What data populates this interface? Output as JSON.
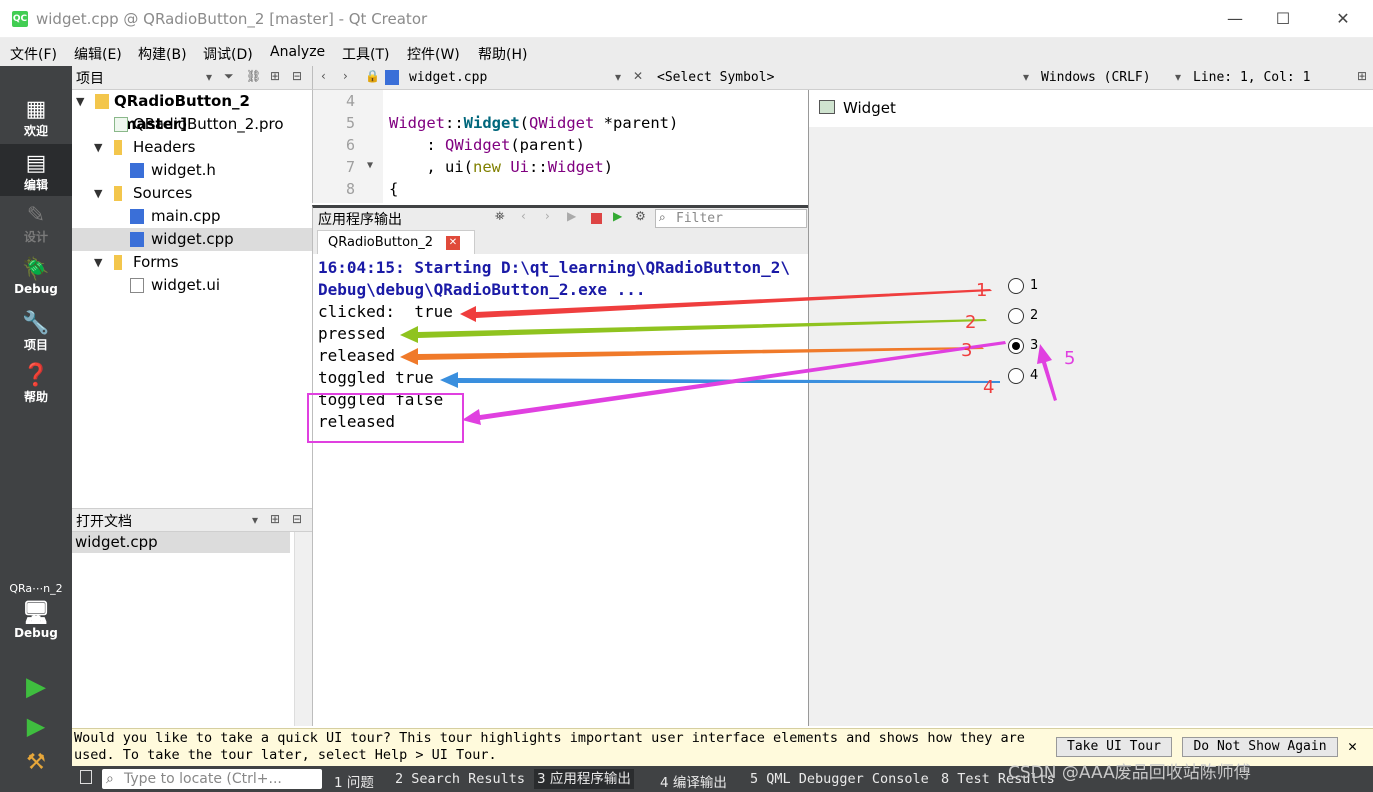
{
  "window": {
    "title": "widget.cpp @ QRadioButton_2 [master] - Qt Creator",
    "app_icon": "QC",
    "min": "—",
    "max": "☐",
    "close": "✕"
  },
  "menu": [
    "文件(F)",
    "编辑(E)",
    "构建(B)",
    "调试(D)",
    "Analyze",
    "工具(T)",
    "控件(W)",
    "帮助(H)"
  ],
  "modes": {
    "welcome": "欢迎",
    "edit": "编辑",
    "design": "设计",
    "debug": "Debug",
    "projects": "项目",
    "help": "帮助",
    "kit_name": "QRa⋯n_2",
    "kit_mode": "Debug"
  },
  "project_panel": {
    "title": "项目",
    "tree": {
      "root": "QRadioButton_2 [master]",
      "pro": "QRadioButton_2.pro",
      "headers": "Headers",
      "widget_h": "widget.h",
      "sources": "Sources",
      "main_cpp": "main.cpp",
      "widget_cpp": "widget.cpp",
      "forms": "Forms",
      "widget_ui": "widget.ui"
    }
  },
  "open_docs": {
    "title": "打开文档",
    "items": [
      "widget.cpp"
    ]
  },
  "editor": {
    "file": "widget.cpp",
    "symbol": "<Select Symbol>",
    "line_ending": "Windows (CRLF)",
    "position": "Line: 1, Col: 1",
    "line_numbers": [
      "4",
      "5",
      "6",
      "7",
      "8"
    ],
    "code": {
      "l5_a": "Widget",
      "l5_b": "::",
      "l5_c": "Widget",
      "l5_d": "(",
      "l5_e": "QWidget",
      "l5_f": " *parent)",
      "l6_a": "    : ",
      "l6_b": "QWidget",
      "l6_c": "(parent)",
      "l7_a": "    , ui(",
      "l7_b": "new",
      "l7_c": " ",
      "l7_d": "Ui",
      "l7_e": "::",
      "l7_f": "Widget",
      "l7_g": ")",
      "l8": "{"
    }
  },
  "output_pane": {
    "title": "应用程序输出",
    "filter_placeholder": "Filter",
    "tab": "QRadioButton_2",
    "lines": [
      "16:04:15: Starting D:\\qt_learning\\QRadioButton_2\\",
      "Debug\\debug\\QRadioButton_2.exe ...",
      "clicked:  true",
      "pressed",
      "released",
      "toggled true",
      "toggled false",
      "released"
    ]
  },
  "widget_window": {
    "title": "Widget",
    "radios": [
      {
        "label": "1",
        "checked": false
      },
      {
        "label": "2",
        "checked": false
      },
      {
        "label": "3",
        "checked": true
      },
      {
        "label": "4",
        "checked": false
      }
    ]
  },
  "annotations": {
    "numbers": [
      "1",
      "2",
      "3",
      "4",
      "5"
    ],
    "colors": {
      "a1": "#ef3e3e",
      "a2": "#8fc31f",
      "a3": "#f07a2a",
      "a4": "#3a8fde",
      "a5": "#e83ee8"
    }
  },
  "tour_banner": {
    "line1": "Would you like to take a quick UI tour? This tour highlights important user interface elements and shows how they are",
    "line2": "used. To take the tour later, select Help > UI Tour.",
    "take": "Take UI Tour",
    "dont": "Do Not Show Again",
    "close": "✕"
  },
  "statusbar": {
    "locate_placeholder": "Type to locate (Ctrl+...",
    "tabs": [
      "1 问题",
      "2 Search Results",
      "3 应用程序输出",
      "4 编译输出",
      "5 QML Debugger Console",
      "8 Test Results"
    ],
    "watermark": "CSDN @AAA废品回收站陈师傅"
  }
}
